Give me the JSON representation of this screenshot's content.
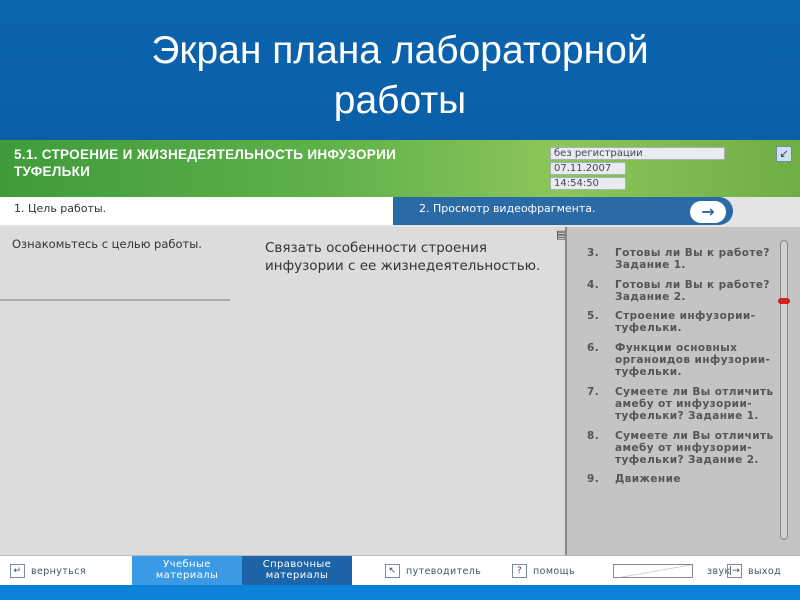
{
  "title": "Экран плана лабораторной работы",
  "title_line1": "Экран плана лабораторной",
  "title_line2": "работы",
  "header": {
    "topic_line1": "5.1. СТРОЕНИЕ И ЖИЗНЕДЕЯТЕЛЬНОСТЬ ИНФУЗОРИИ",
    "topic_line2": "ТУФЕЛЬКИ",
    "user": "без регистрации",
    "date": "07.11.2007",
    "time": "14:54:50"
  },
  "tabs": {
    "current": "1. Цель работы.",
    "next": "2. Просмотр видеофрагмента."
  },
  "content": {
    "instruction": "Ознакомьтесь с целью работы.",
    "goal": "Связать особенности строения инфузории с ее жизнедеятельностью."
  },
  "plan": [
    {
      "num": "3.",
      "text": "Готовы ли Вы к работе? Задание 1."
    },
    {
      "num": "4.",
      "text": "Готовы ли Вы к работе? Задание 2."
    },
    {
      "num": "5.",
      "text": "Строение инфузории-туфельки."
    },
    {
      "num": "6.",
      "text": "Функции основных органоидов инфузории-туфельки."
    },
    {
      "num": "7.",
      "text": "Сумеете ли Вы отличить амебу от инфузории-туфельки? Задание 1."
    },
    {
      "num": "8.",
      "text": "Сумеете ли Вы отличить амебу от инфузории-туфельки? Задание 2."
    },
    {
      "num": "9.",
      "text": "Движение"
    }
  ],
  "nav": {
    "back": "вернуться",
    "study_line1": "Учебные",
    "study_line2": "материалы",
    "ref_line1": "Справочные",
    "ref_line2": "материалы",
    "guide": "путеводитель",
    "help_icon": "?",
    "help": "помощь",
    "sound": "звук",
    "exit": "выход"
  }
}
